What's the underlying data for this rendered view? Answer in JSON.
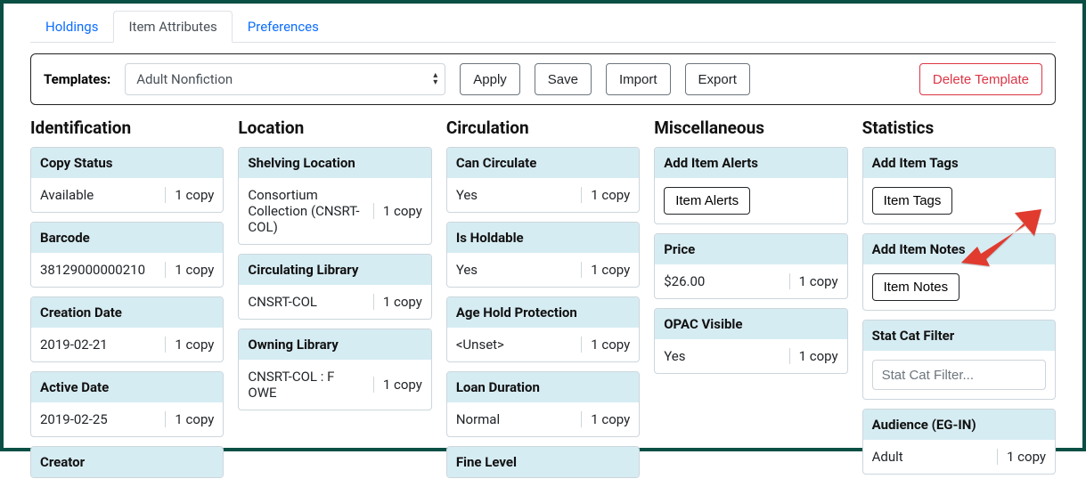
{
  "tabs": {
    "holdings": "Holdings",
    "item_attributes": "Item Attributes",
    "preferences": "Preferences"
  },
  "templates": {
    "label": "Templates:",
    "selected": "Adult Nonfiction",
    "apply": "Apply",
    "save": "Save",
    "import": "Import",
    "export": "Export",
    "delete": "Delete Template"
  },
  "columns": {
    "identification": {
      "title": "Identification",
      "copy_status": {
        "label": "Copy Status",
        "value": "Available",
        "count": "1 copy"
      },
      "barcode": {
        "label": "Barcode",
        "value": "38129000000210",
        "count": "1 copy"
      },
      "creation_date": {
        "label": "Creation Date",
        "value": "2019-02-21",
        "count": "1 copy"
      },
      "active_date": {
        "label": "Active Date",
        "value": "2019-02-25",
        "count": "1 copy"
      },
      "creator": {
        "label": "Creator"
      }
    },
    "location": {
      "title": "Location",
      "shelving_location": {
        "label": "Shelving Location",
        "value": "Consortium Collection (CNSRT-COL)",
        "count": "1 copy"
      },
      "circulating_library": {
        "label": "Circulating Library",
        "value": "CNSRT-COL",
        "count": "1 copy"
      },
      "owning_library": {
        "label": "Owning Library",
        "value": "CNSRT-COL : F OWE",
        "count": "1 copy"
      }
    },
    "circulation": {
      "title": "Circulation",
      "can_circulate": {
        "label": "Can Circulate",
        "value": "Yes",
        "count": "1 copy"
      },
      "is_holdable": {
        "label": "Is Holdable",
        "value": "Yes",
        "count": "1 copy"
      },
      "age_hold_protection": {
        "label": "Age Hold Protection",
        "value": "<Unset>",
        "count": "1 copy"
      },
      "loan_duration": {
        "label": "Loan Duration",
        "value": "Normal",
        "count": "1 copy"
      },
      "fine_level": {
        "label": "Fine Level"
      }
    },
    "miscellaneous": {
      "title": "Miscellaneous",
      "add_item_alerts": {
        "label": "Add Item Alerts",
        "button": "Item Alerts"
      },
      "price": {
        "label": "Price",
        "value": "$26.00",
        "count": "1 copy"
      },
      "opac_visible": {
        "label": "OPAC Visible",
        "value": "Yes",
        "count": "1 copy"
      }
    },
    "statistics": {
      "title": "Statistics",
      "add_item_tags": {
        "label": "Add Item Tags",
        "button": "Item Tags"
      },
      "add_item_notes": {
        "label": "Add Item Notes",
        "button": "Item Notes"
      },
      "stat_cat_filter": {
        "label": "Stat Cat Filter",
        "placeholder": "Stat Cat Filter..."
      },
      "audience": {
        "label": "Audience (EG-IN)",
        "value": "Adult",
        "count": "1 copy"
      }
    }
  }
}
